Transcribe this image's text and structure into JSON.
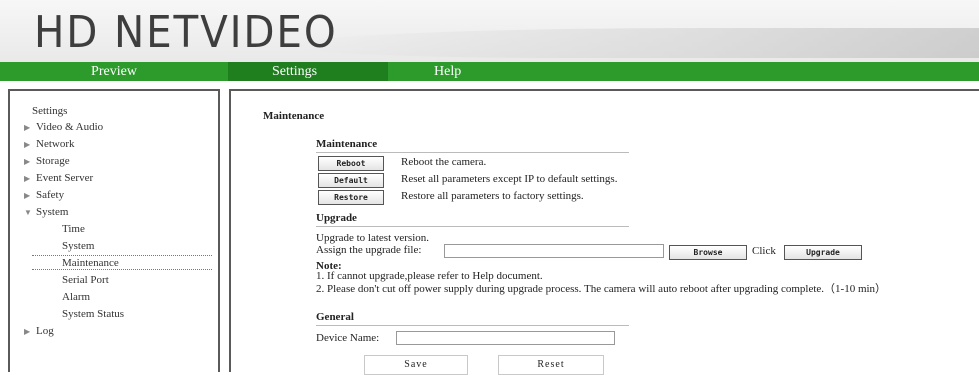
{
  "logo": {
    "text": "HD NETVIDEO"
  },
  "nav": {
    "preview": "Preview",
    "settings": "Settings",
    "help": "Help"
  },
  "sidebar": {
    "heading": "Settings",
    "items": [
      {
        "label": "Video & Audio"
      },
      {
        "label": "Network"
      },
      {
        "label": "Storage"
      },
      {
        "label": "Event Server"
      },
      {
        "label": "Safety"
      },
      {
        "label": "System"
      },
      {
        "label": "Log"
      }
    ],
    "system_sub": [
      {
        "label": "Time"
      },
      {
        "label": "System"
      },
      {
        "label": "Maintenance"
      },
      {
        "label": "Serial Port"
      },
      {
        "label": "Alarm"
      },
      {
        "label": "System Status"
      }
    ]
  },
  "main": {
    "page_title": "Maintenance",
    "maintenance": {
      "title": "Maintenance",
      "reboot_btn": "Reboot",
      "reboot_desc": "Reboot the camera.",
      "default_btn": "Default",
      "default_desc": "Reset all parameters except IP to default settings.",
      "restore_btn": "Restore",
      "restore_desc": "Restore all parameters to factory settings."
    },
    "upgrade": {
      "title": "Upgrade",
      "desc": "Upgrade to latest version.",
      "file_label": "Assign the upgrade file:",
      "file_value": "",
      "browse_btn": "Browse",
      "click_label": "Click",
      "upgrade_btn": "Upgrade",
      "note_title": "Note:",
      "note1": "1. If cannot upgrade,please refer to Help document.",
      "note2": "2. Please don't cut off power supply during upgrade process. The camera will auto reboot after upgrading complete.（1-10 min）"
    },
    "general": {
      "title": "General",
      "device_name_label": "Device Name:",
      "device_name_value": ""
    },
    "save_btn": "Save",
    "reset_btn": "Reset"
  }
}
